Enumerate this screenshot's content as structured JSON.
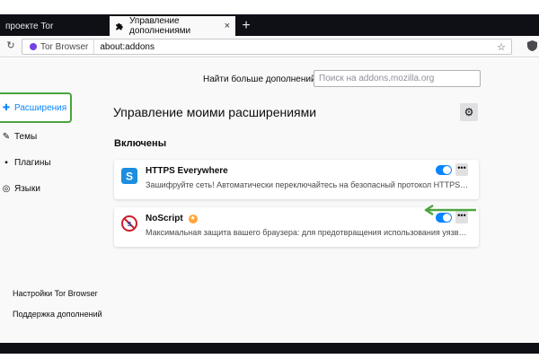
{
  "tabs": [
    {
      "label": "проекте Tor"
    },
    {
      "label": "Управление дополнениями",
      "close": "×"
    }
  ],
  "new_tab": "+",
  "navbar": {
    "identity": "Tor Browser",
    "url": "about:addons"
  },
  "header": {
    "find_more": "Найти больше дополнений",
    "search_placeholder": "Поиск на addons.mozilla.org"
  },
  "sidebar": {
    "items": [
      {
        "label": "Расширения",
        "icon": "puzzle-icon"
      },
      {
        "label": "Темы",
        "icon": "brush-icon"
      },
      {
        "label": "Плагины",
        "icon": "plugin-icon"
      },
      {
        "label": "Языки",
        "icon": "languages-icon"
      }
    ],
    "footer": [
      {
        "label": "Настройки Tor Browser",
        "icon": "gear-icon"
      },
      {
        "label": "Поддержка дополнений",
        "icon": "help-icon"
      }
    ]
  },
  "main": {
    "title": "Управление моими расширениями",
    "section": "Включены",
    "extensions": [
      {
        "name": "HTTPS Everywhere",
        "description": "Зашифруйте сеть! Автоматически переключайтесь на безопасный протокол HTTPS там, г...",
        "enabled": true,
        "more": "•••"
      },
      {
        "name": "NoScript",
        "description": "Максимальная защита вашего браузера: для предотвращения использования уязвимосте...",
        "enabled": true,
        "more": "•••"
      }
    ]
  },
  "colors": {
    "accent": "#0a84ff",
    "highlight": "#4ba43f",
    "tabbar": "#0f1016"
  }
}
